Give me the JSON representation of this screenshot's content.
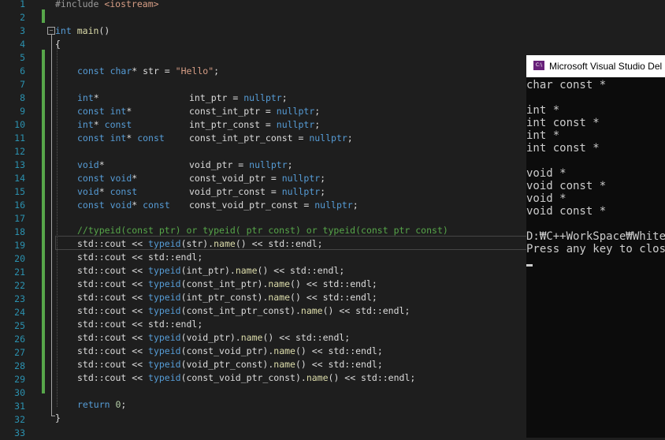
{
  "editor": {
    "line_numbers": [
      "1",
      "2",
      "3",
      "4",
      "5",
      "6",
      "7",
      "8",
      "9",
      "10",
      "11",
      "12",
      "13",
      "14",
      "15",
      "16",
      "17",
      "18",
      "19",
      "20",
      "21",
      "22",
      "23",
      "24",
      "25",
      "26",
      "27",
      "28",
      "29",
      "30",
      "31",
      "32",
      "33"
    ],
    "fold_marker": "−",
    "colors": {
      "background": "#1e1e1e",
      "keyword": "#569cd6",
      "function": "#dcdcaa",
      "string": "#d69d85",
      "comment": "#57a64a",
      "line_number": "#2b91af",
      "change_bar": "#57a64a"
    }
  },
  "console": {
    "title": "Microsoft Visual Studio Del",
    "icon": "visual-studio-console-icon",
    "icon_text": "C:\\",
    "lines": [
      "char const *",
      "",
      "int *",
      "int const *",
      "int *",
      "int const *",
      "",
      "void *",
      "void const *",
      "void *",
      "void const *",
      "",
      "D:₩C++WorkSpace₩WhiteB",
      "Press any key to close"
    ]
  }
}
